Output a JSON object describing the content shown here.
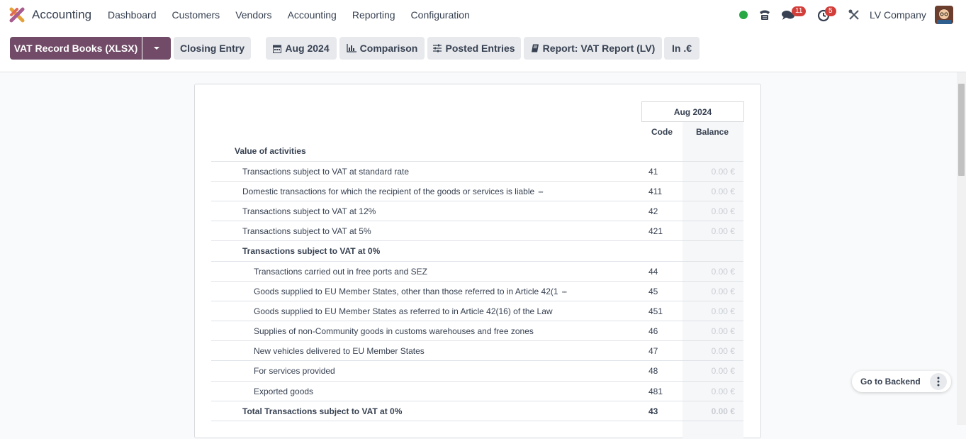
{
  "app": {
    "name": "Accounting"
  },
  "menu": [
    "Dashboard",
    "Customers",
    "Vendors",
    "Accounting",
    "Reporting",
    "Configuration"
  ],
  "systray": {
    "messages_count": "11",
    "activities_count": "5",
    "company": "LV Company"
  },
  "control_panel": {
    "primary_button": "VAT Record Books (XLSX)",
    "closing_entry": "Closing Entry",
    "filters": {
      "period": "Aug 2024",
      "comparison": "Comparison",
      "posted": "Posted Entries",
      "report": "Report: VAT Report (LV)",
      "currency": "In .€"
    }
  },
  "report": {
    "period_header": "Aug 2024",
    "col_code": "Code",
    "col_balance": "Balance",
    "section_title": "Value of activities",
    "rows": [
      {
        "label": "Transactions subject to VAT at standard rate",
        "code": "41",
        "balance": "0.00 €"
      },
      {
        "label": "Domestic transactions for which the recipient of the goods or services is liable",
        "code": "411",
        "balance": "0.00 €"
      },
      {
        "label": "Transactions subject to VAT at 12%",
        "code": "42",
        "balance": "0.00 €"
      },
      {
        "label": "Transactions subject to VAT at 5%",
        "code": "421",
        "balance": "0.00 €"
      },
      {
        "label": "Transactions subject to VAT at 0%",
        "code": "",
        "balance": ""
      },
      {
        "label": "Transactions carried out in free ports and SEZ",
        "code": "44",
        "balance": "0.00 €"
      },
      {
        "label": "Goods supplied to EU Member States, other than those referred to in Article 42(1",
        "code": "45",
        "balance": "0.00 €"
      },
      {
        "label": "Goods supplied to EU Member States as referred to in Article 42(16) of the Law",
        "code": "451",
        "balance": "0.00 €"
      },
      {
        "label": "Supplies of non-Community goods in customs warehouses and free zones",
        "code": "46",
        "balance": "0.00 €"
      },
      {
        "label": "New vehicles delivered to EU Member States",
        "code": "47",
        "balance": "0.00 €"
      },
      {
        "label": "For services provided",
        "code": "48",
        "balance": "0.00 €"
      },
      {
        "label": "Exported goods",
        "code": "481",
        "balance": "0.00 €"
      },
      {
        "label": "Total Transactions subject to VAT at 0%",
        "code": "43",
        "balance": "0.00 €"
      }
    ]
  },
  "floating": {
    "go_backend": "Go to Backend"
  }
}
